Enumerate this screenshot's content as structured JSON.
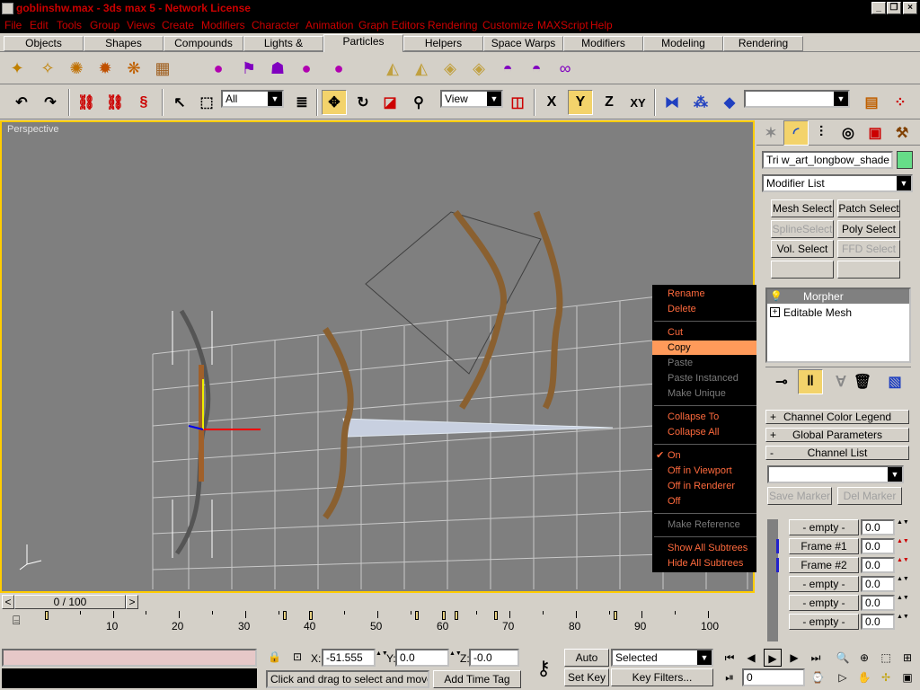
{
  "window": {
    "title": "goblinshw.max - 3ds max 5 - Network License",
    "minimize_glyph": "_",
    "restore_glyph": "❐",
    "close_glyph": "×"
  },
  "menu": [
    "File",
    "Edit",
    "Tools",
    "Group",
    "Views",
    "Create",
    "Modifiers",
    "Character",
    "Animation",
    "Graph Editors",
    "Rendering",
    "Customize",
    "MAXScript",
    "Help"
  ],
  "tabs": [
    "Objects",
    "Shapes",
    "Compounds",
    "Lights & Cameras",
    "Particles",
    "Helpers",
    "Space Warps",
    "Modifiers",
    "Modeling",
    "Rendering"
  ],
  "active_tab": "Particles",
  "toolbar": {
    "selection_filter": "All",
    "ref_coord": "View",
    "axis_x": "X",
    "axis_y": "Y",
    "axis_z": "Z",
    "axis_xy": "XY",
    "named_selection": ""
  },
  "viewport": {
    "label": "Perspective"
  },
  "command_panel": {
    "object_name": "Tri w_art_longbow_shade",
    "object_color": "#66dd88",
    "modifier_list": "Modifier List",
    "buttons": [
      {
        "label": "Mesh Select",
        "enabled": true
      },
      {
        "label": "Patch Select",
        "enabled": true
      },
      {
        "label": "SplineSelect",
        "enabled": false
      },
      {
        "label": "Poly Select",
        "enabled": true
      },
      {
        "label": "Vol. Select",
        "enabled": true
      },
      {
        "label": "FFD Select",
        "enabled": false
      }
    ],
    "stack": [
      {
        "label": "Morpher",
        "selected": true,
        "prefix": ""
      },
      {
        "label": "Editable Mesh",
        "selected": false,
        "prefix": "+"
      }
    ],
    "rollouts": [
      {
        "label": "Channel Color Legend",
        "pm": "+"
      },
      {
        "label": "Global Parameters",
        "pm": "+"
      },
      {
        "label": "Channel List",
        "pm": "-"
      }
    ],
    "save_marker": "Save Marker",
    "del_marker": "Del Marker",
    "channels": [
      {
        "label": "- empty -",
        "value": "0.0",
        "marked": false
      },
      {
        "label": "Frame #1",
        "value": "0.0",
        "marked": true
      },
      {
        "label": "Frame #2",
        "value": "0.0",
        "marked": true
      },
      {
        "label": "- empty -",
        "value": "0.0",
        "marked": false
      },
      {
        "label": "- empty -",
        "value": "0.0",
        "marked": false
      },
      {
        "label": "- empty -",
        "value": "0.0",
        "marked": false
      }
    ]
  },
  "context_menu": {
    "items": [
      {
        "label": "Rename",
        "state": "normal"
      },
      {
        "label": "Delete",
        "state": "normal"
      },
      {
        "sep": true
      },
      {
        "label": "Cut",
        "state": "normal"
      },
      {
        "label": "Copy",
        "state": "highlight"
      },
      {
        "label": "Paste",
        "state": "disabled"
      },
      {
        "label": "Paste Instanced",
        "state": "disabled"
      },
      {
        "label": "Make Unique",
        "state": "disabled"
      },
      {
        "sep": true
      },
      {
        "label": "Collapse To",
        "state": "normal"
      },
      {
        "label": "Collapse All",
        "state": "normal"
      },
      {
        "sep": true
      },
      {
        "label": "On",
        "state": "checked"
      },
      {
        "label": "Off in Viewport",
        "state": "normal"
      },
      {
        "label": "Off in Renderer",
        "state": "normal"
      },
      {
        "label": "Off",
        "state": "normal"
      },
      {
        "sep": true
      },
      {
        "label": "Make Reference",
        "state": "disabled"
      },
      {
        "sep": true
      },
      {
        "label": "Show All Subtrees",
        "state": "normal"
      },
      {
        "label": "Hide All Subtrees",
        "state": "normal"
      }
    ]
  },
  "timeline": {
    "slider_text": "0 / 100",
    "prev": "<",
    "next": ">",
    "ticks": [
      "10",
      "20",
      "30",
      "40",
      "50",
      "60",
      "70",
      "80",
      "90",
      "100"
    ]
  },
  "status": {
    "prompt": "Click and drag to select and move obj",
    "add_time_tag": "Add Time Tag",
    "x_label": "X:",
    "x_value": "-51.555",
    "y_label": "Y:",
    "y_value": "0.0",
    "z_label": "Z:",
    "z_value": "-0.0",
    "auto_key": "Auto Key",
    "set_key": "Set Key",
    "key_mode": "Selected",
    "key_filters": "Key Filters...",
    "current_frame": "0"
  }
}
